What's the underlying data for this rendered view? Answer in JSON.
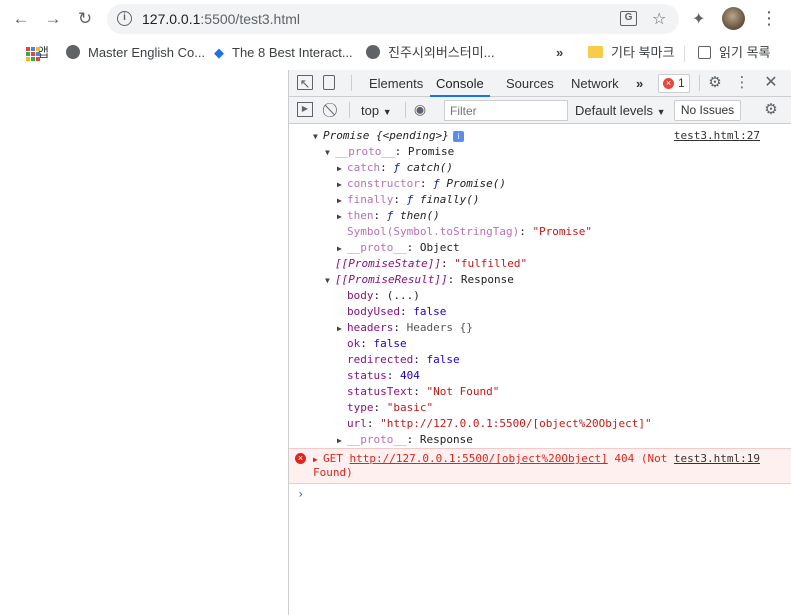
{
  "browser": {
    "url_host": "127.0.0.1",
    "url_rest": ":5500/test3.html"
  },
  "bookmarks": [
    {
      "label": "앱"
    },
    {
      "label": "Master English Co..."
    },
    {
      "label": "The 8 Best Interact..."
    },
    {
      "label": "진주시외버스터미..."
    },
    {
      "label": "»"
    },
    {
      "label": "기타 북마크"
    },
    {
      "label": "읽기 목록"
    }
  ],
  "devtools": {
    "tabs": [
      "Elements",
      "Console",
      "Sources",
      "Network",
      "»"
    ],
    "active_tab": "Console",
    "error_count": "1",
    "context": "top",
    "filter_placeholder": "Filter",
    "levels": "Default levels",
    "issues": "No Issues"
  },
  "console": {
    "promise_header": "Promise {<pending>}",
    "source1": "test3.html:27",
    "proto_label": "__proto__",
    "proto_value": "Promise",
    "methods": [
      {
        "key": "catch",
        "value": "catch()"
      },
      {
        "key": "constructor",
        "value": "Promise()"
      },
      {
        "key": "finally",
        "value": "finally()"
      },
      {
        "key": "then",
        "value": "then()"
      }
    ],
    "symbol_key": "Symbol(Symbol.toStringTag)",
    "symbol_value": "\"Promise\"",
    "inner_proto_value": "Object",
    "state_key": "[[PromiseState]]",
    "state_value": "\"fulfilled\"",
    "result_key": "[[PromiseResult]]",
    "result_value": "Response",
    "response_props": [
      {
        "key": "body",
        "value": "(...)"
      },
      {
        "key": "bodyUsed",
        "value": "false"
      },
      {
        "key": "headers",
        "value": "Headers {}"
      },
      {
        "key": "ok",
        "value": "false"
      },
      {
        "key": "redirected",
        "value": "false"
      },
      {
        "key": "status",
        "value": "404"
      },
      {
        "key": "statusText",
        "value": "\"Not Found\""
      },
      {
        "key": "type",
        "value": "\"basic\""
      },
      {
        "key": "url",
        "value": "\"http://127.0.0.1:5500/[object%20Object]\""
      }
    ],
    "response_proto_value": "Response",
    "error_method": "GET",
    "error_url": "http://127.0.0.1:5500/[object%20Object]",
    "error_status": "404 (Not",
    "error_status2": "Found)",
    "source2": "test3.html:19"
  }
}
